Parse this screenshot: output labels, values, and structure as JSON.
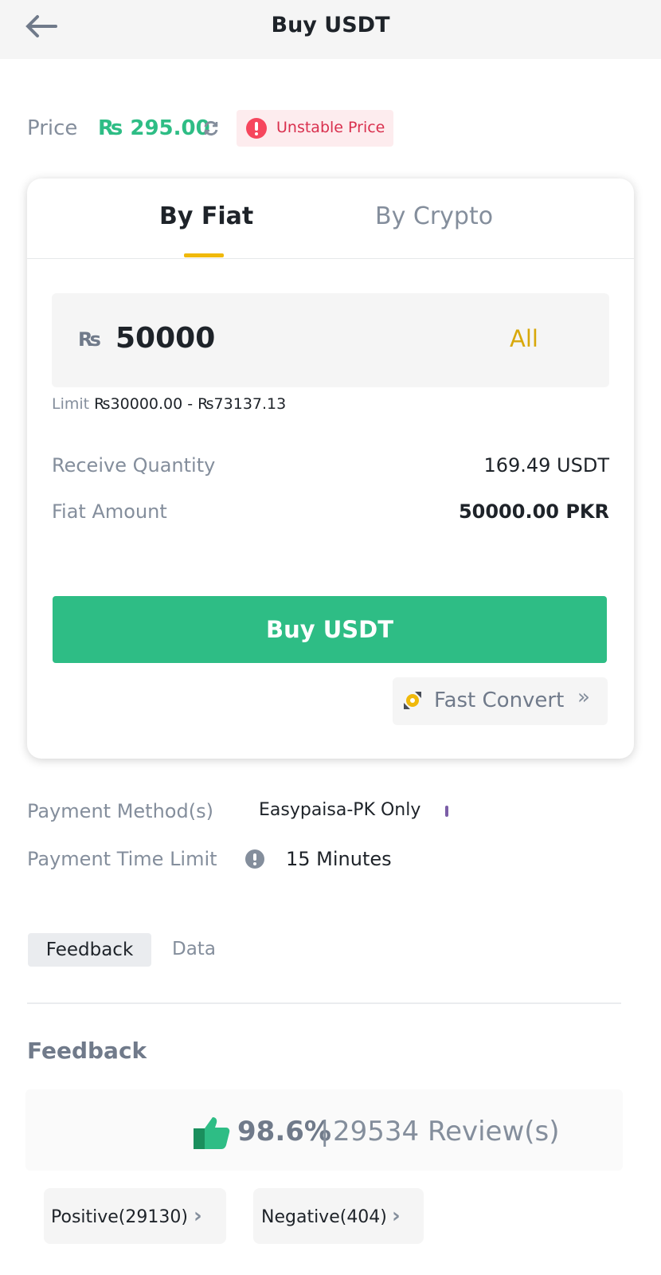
{
  "header": {
    "title": "Buy USDT"
  },
  "price": {
    "label": "Price",
    "value": "₨ 295.00",
    "badge": "Unstable Price"
  },
  "tabs": [
    {
      "label": "By Fiat",
      "active": true
    },
    {
      "label": "By Crypto",
      "active": false
    }
  ],
  "input": {
    "currency": "₨",
    "value": "50000",
    "all": "All"
  },
  "limit": {
    "label": "Limit",
    "value": "₨30000.00 - ₨73137.13"
  },
  "receive": {
    "label": "Receive Quantity",
    "value": "169.49 USDT"
  },
  "fiat": {
    "label": "Fiat Amount",
    "value": "50000.00 PKR"
  },
  "buy_button": "Buy USDT",
  "fast_convert": "Fast Convert",
  "payment": {
    "method_label": "Payment Method(s)",
    "method_value": "Easypaisa-PK Only",
    "time_label": "Payment Time Limit",
    "time_value": "15 Minutes"
  },
  "section_tabs": [
    {
      "label": "Feedback",
      "active": true
    },
    {
      "label": "Data",
      "active": false
    }
  ],
  "feedback": {
    "title": "Feedback",
    "rate": "98.6%",
    "separator": "|",
    "reviews": "29534 Review(s)",
    "positive": "Positive(29130)",
    "negative": "Negative(404)"
  },
  "colors": {
    "green": "#2ebd85",
    "yellow": "#f0b90b",
    "red": "#f6465d"
  }
}
